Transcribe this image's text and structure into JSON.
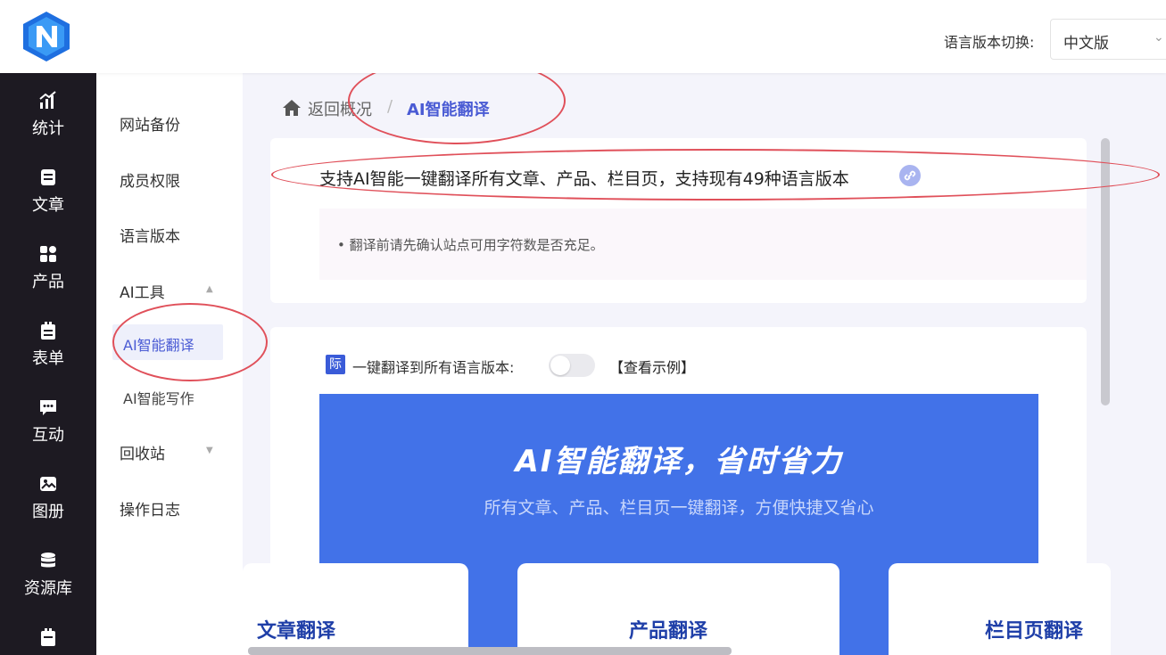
{
  "header": {
    "lang_switch_label": "语言版本切换:",
    "lang_selected": "中文版"
  },
  "primary_nav": [
    {
      "label": "统计",
      "icon": "chart-icon"
    },
    {
      "label": "文章",
      "icon": "article-icon"
    },
    {
      "label": "产品",
      "icon": "product-icon"
    },
    {
      "label": "表单",
      "icon": "form-icon"
    },
    {
      "label": "互动",
      "icon": "chat-icon"
    },
    {
      "label": "图册",
      "icon": "gallery-icon"
    },
    {
      "label": "资源库",
      "icon": "database-icon"
    }
  ],
  "sub_nav": {
    "items": [
      "网站备份",
      "成员权限",
      "语言版本",
      "AI工具",
      "回收站",
      "操作日志"
    ],
    "ai_children": [
      "AI智能翻译",
      "AI智能写作"
    ]
  },
  "breadcrumb": {
    "back": "返回概况",
    "separator": "/",
    "current": "AI智能翻译"
  },
  "intro": {
    "headline": "支持AI智能一键翻译所有文章、产品、栏目页，支持现有49种语言版本",
    "notice": "• 翻译前请先确认站点可用字符数是否充足。"
  },
  "translate": {
    "badge": "际",
    "toggle_label": "一键翻译到所有语言版本:",
    "toggle_on": false,
    "example_link": "【查看示例】"
  },
  "banner": {
    "title": "AI智能翻译，省时省力",
    "subtitle": "所有文章、产品、栏目页一键翻译，方便快捷又省心"
  },
  "feature_cards": [
    "文章翻译",
    "产品翻译",
    "栏目页翻译"
  ],
  "colors": {
    "accent": "#4a5bd4",
    "banner": "#4272e8",
    "sidebar": "#1d1a22",
    "annotation": "#e0505a"
  }
}
